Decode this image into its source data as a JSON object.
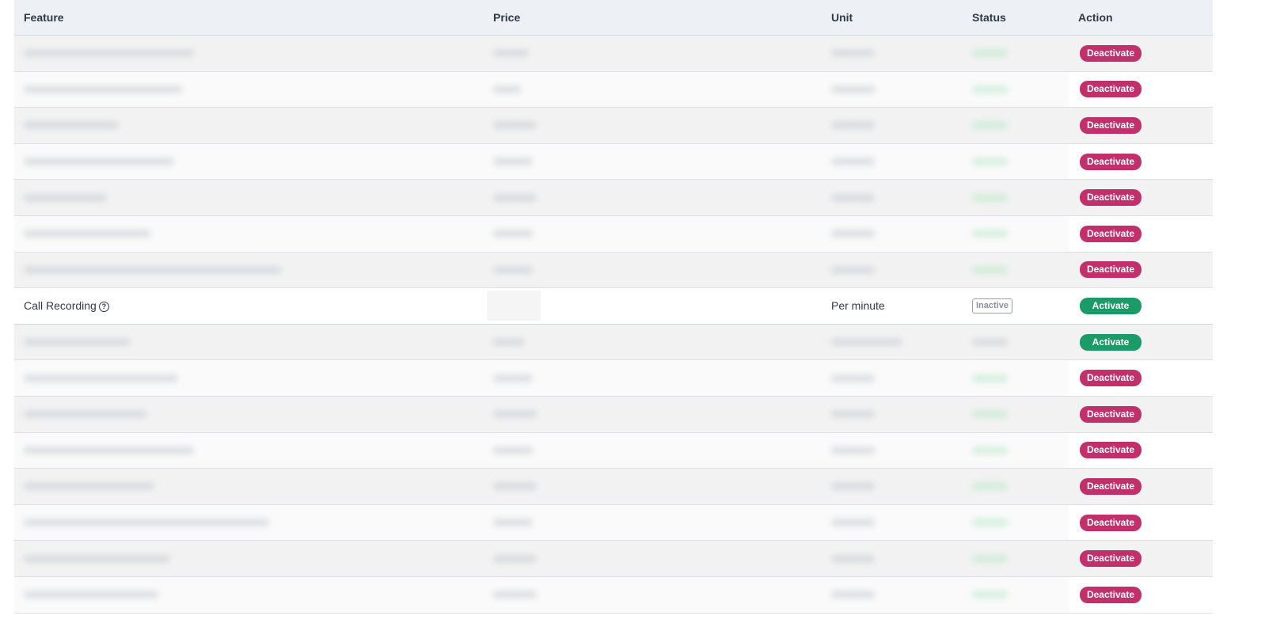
{
  "table": {
    "headers": {
      "feature": "Feature",
      "price": "Price",
      "unit": "Unit",
      "status": "Status",
      "action": "Action"
    },
    "rows": [
      {
        "feature": "",
        "price": "",
        "unit": "",
        "status": "",
        "action": "Deactivate",
        "obscured": true
      },
      {
        "feature": "",
        "price": "",
        "unit": "",
        "status": "",
        "action": "Deactivate",
        "obscured": true
      },
      {
        "feature": "",
        "price": "",
        "unit": "",
        "status": "",
        "action": "Deactivate",
        "obscured": true
      },
      {
        "feature": "",
        "price": "",
        "unit": "",
        "status": "",
        "action": "Deactivate",
        "obscured": true
      },
      {
        "feature": "",
        "price": "",
        "unit": "",
        "status": "",
        "action": "Deactivate",
        "obscured": true
      },
      {
        "feature": "",
        "price": "",
        "unit": "",
        "status": "",
        "action": "Deactivate",
        "obscured": true
      },
      {
        "feature": "",
        "price": "",
        "unit": "",
        "status": "",
        "action": "Deactivate",
        "obscured": true
      },
      {
        "feature": "Call Recording",
        "price": "",
        "unit": "Per minute",
        "status": "Inactive",
        "action": "Activate",
        "obscured": false
      },
      {
        "feature": "",
        "price": "",
        "unit": "",
        "status": "",
        "action": "Activate",
        "obscured": true
      },
      {
        "feature": "",
        "price": "",
        "unit": "",
        "status": "",
        "action": "Deactivate",
        "obscured": true
      },
      {
        "feature": "",
        "price": "",
        "unit": "",
        "status": "",
        "action": "Deactivate",
        "obscured": true
      },
      {
        "feature": "",
        "price": "",
        "unit": "",
        "status": "",
        "action": "Deactivate",
        "obscured": true
      },
      {
        "feature": "",
        "price": "",
        "unit": "",
        "status": "",
        "action": "Deactivate",
        "obscured": true
      },
      {
        "feature": "",
        "price": "",
        "unit": "",
        "status": "",
        "action": "Deactivate",
        "obscured": true
      },
      {
        "feature": "",
        "price": "",
        "unit": "",
        "status": "",
        "action": "Deactivate",
        "obscured": true
      },
      {
        "feature": "",
        "price": "",
        "unit": "",
        "status": "",
        "action": "Deactivate",
        "obscured": true
      }
    ]
  },
  "icons": {
    "help": "question-circle-icon"
  },
  "colors": {
    "deactivate": "#c0316b",
    "activate": "#1a9b67",
    "header_bg": "#edf1f5"
  }
}
